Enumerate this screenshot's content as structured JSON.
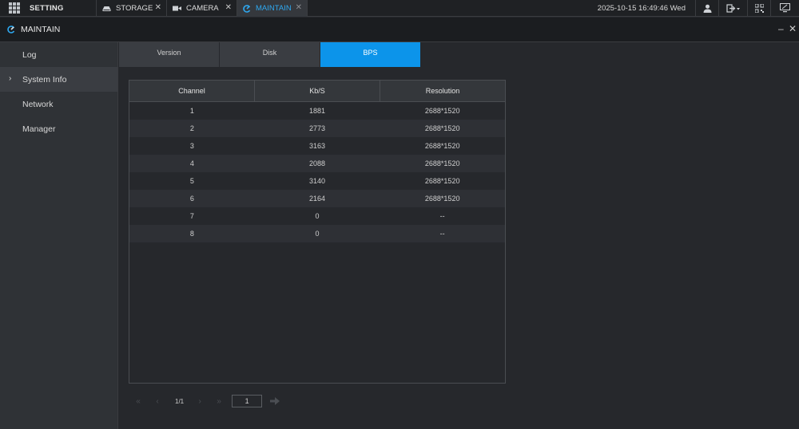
{
  "topbar": {
    "setting_label": "SETTING",
    "tabs": [
      {
        "label": "STORAGE",
        "icon": "storage-icon"
      },
      {
        "label": "CAMERA",
        "icon": "camera-icon"
      },
      {
        "label": "MAINTAIN",
        "icon": "maintain-icon",
        "active": true
      }
    ],
    "datetime": "2025-10-15 16:49:46 Wed"
  },
  "titlebar": {
    "title": "MAINTAIN"
  },
  "sidebar": {
    "items": [
      {
        "label": "Log"
      },
      {
        "label": "System Info",
        "active": true
      },
      {
        "label": "Network"
      },
      {
        "label": "Manager"
      }
    ]
  },
  "subtabs": [
    {
      "label": "Version"
    },
    {
      "label": "Disk"
    },
    {
      "label": "BPS",
      "active": true
    }
  ],
  "table": {
    "headers": [
      "Channel",
      "Kb/S",
      "Resolution"
    ],
    "rows": [
      [
        "1",
        "1881",
        "2688*1520"
      ],
      [
        "2",
        "2773",
        "2688*1520"
      ],
      [
        "3",
        "3163",
        "2688*1520"
      ],
      [
        "4",
        "2088",
        "2688*1520"
      ],
      [
        "5",
        "3140",
        "2688*1520"
      ],
      [
        "6",
        "2164",
        "2688*1520"
      ],
      [
        "7",
        "0",
        "--"
      ],
      [
        "8",
        "0",
        "--"
      ]
    ]
  },
  "pager": {
    "page_info": "1/1",
    "page_input": "1"
  },
  "colors": {
    "accent": "#0c94ea",
    "background": "#26282c",
    "sidebar": "#2f3236"
  }
}
